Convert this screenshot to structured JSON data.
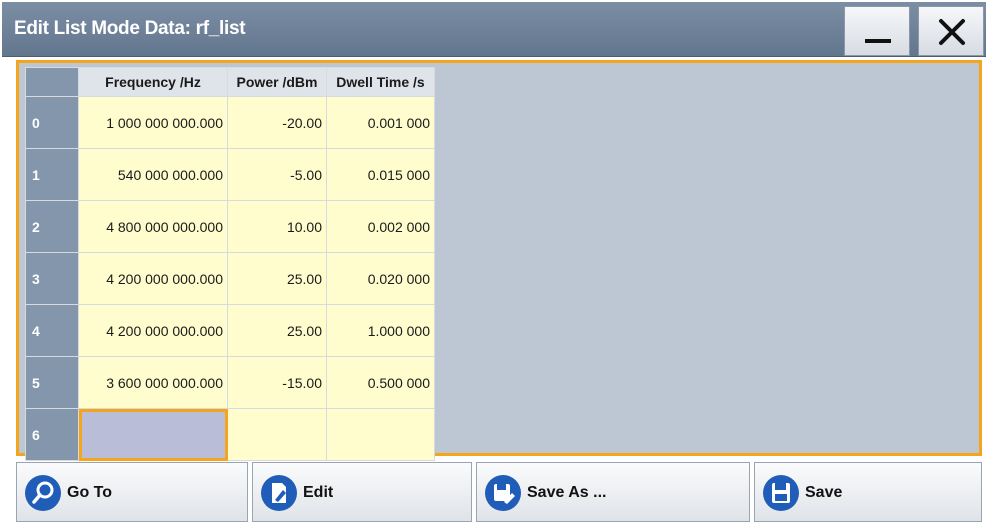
{
  "window": {
    "title": "Edit List Mode Data: rf_list"
  },
  "table": {
    "columns": [
      "Frequency /Hz",
      "Power /dBm",
      "Dwell Time /s"
    ],
    "rows": [
      {
        "index": "0",
        "frequency": "1 000 000 000.000",
        "power": "-20.00",
        "dwell": "0.001 000"
      },
      {
        "index": "1",
        "frequency": "540 000 000.000",
        "power": "-5.00",
        "dwell": "0.015 000"
      },
      {
        "index": "2",
        "frequency": "4 800 000 000.000",
        "power": "10.00",
        "dwell": "0.002 000"
      },
      {
        "index": "3",
        "frequency": "4 200 000 000.000",
        "power": "25.00",
        "dwell": "0.020 000"
      },
      {
        "index": "4",
        "frequency": "4 200 000 000.000",
        "power": "25.00",
        "dwell": "1.000 000"
      },
      {
        "index": "5",
        "frequency": "3 600 000 000.000",
        "power": "-15.00",
        "dwell": "0.500 000"
      },
      {
        "index": "6",
        "frequency": "",
        "power": "",
        "dwell": ""
      }
    ]
  },
  "buttons": [
    {
      "label": "Go To",
      "icon": "search-icon"
    },
    {
      "label": "Edit",
      "icon": "edit-icon"
    },
    {
      "label": "Save As ...",
      "icon": "save-as-icon"
    },
    {
      "label": "Save",
      "icon": "save-icon"
    }
  ],
  "colors": {
    "accent": "#f4a51c",
    "titlebar": "#6b7e95",
    "cell_bg": "#fffdcd",
    "row_header": "#8396ab",
    "icon_blue": "#1f5db8"
  }
}
